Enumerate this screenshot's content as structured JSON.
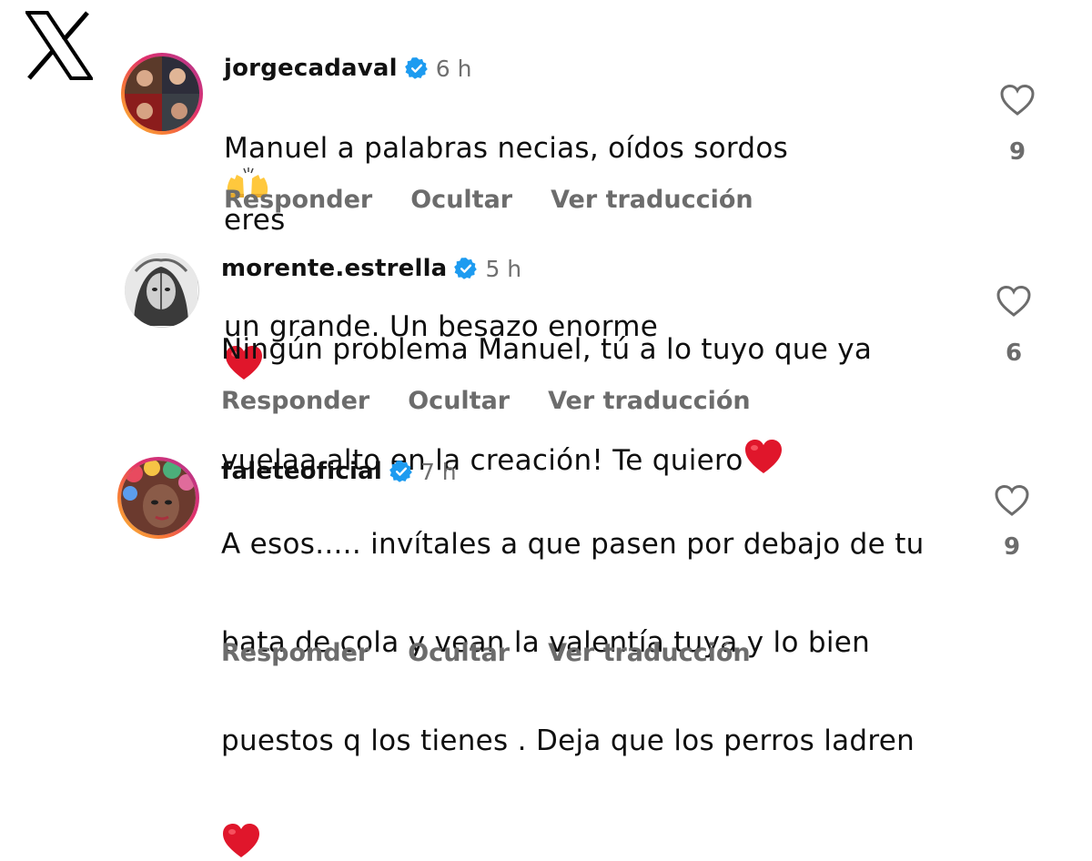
{
  "comments": [
    {
      "username": "jorgecadaval",
      "time": "6 h",
      "text_part1": "Manuel a palabras necias, oídos sordos",
      "text_part2": "eres",
      "text_part3": "un grande. Un besazo enorme",
      "likes": "9",
      "emoji_1": "raising-hands",
      "emoji_2": "red-heart"
    },
    {
      "username": "morente.estrella",
      "time": "5 h",
      "text_part1": "Ningún problema Manuel, tú a lo tuyo que ya",
      "text_part2": "vuelaa alto en la creación! Te quiero",
      "likes": "6",
      "emoji_1": "red-heart"
    },
    {
      "username": "faleteoficial",
      "time": "7 h",
      "text_part1": "A esos..... invítales a que pasen por debajo de tu",
      "text_part2": "bata de cola y vean la valentía tuya y lo bien",
      "text_part3": "puestos q los tienes . Deja que los perros ladren",
      "likes": "9",
      "emoji_1": "red-heart"
    }
  ],
  "actions": {
    "reply": "Responder",
    "hide": "Ocultar",
    "translate": "Ver traducción"
  },
  "colors": {
    "verified": "#1d9bf0",
    "muted": "#6c6c6c",
    "heart_emoji": "#e0162b"
  },
  "icons": {
    "brand": "x-logo-icon",
    "like": "heart-outline-icon",
    "verified": "verified-badge-icon"
  }
}
